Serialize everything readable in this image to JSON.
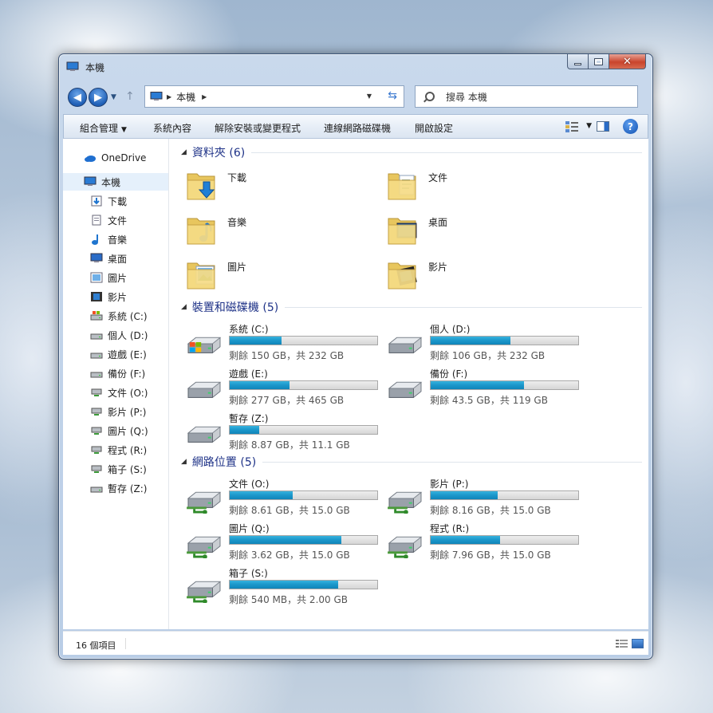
{
  "window": {
    "title": "本機"
  },
  "address": {
    "path": "本機",
    "search_placeholder": "搜尋 本機"
  },
  "toolbar": {
    "organize": "組合管理",
    "system_properties": "系統內容",
    "uninstall": "解除安裝或變更程式",
    "map_network_drive": "連線網路磁碟機",
    "control_panel": "開啟設定"
  },
  "sidebar": {
    "onedrive": "OneDrive",
    "this_pc": "本機",
    "items": [
      {
        "label": "下載",
        "icon": "download-folder-icon"
      },
      {
        "label": "文件",
        "icon": "documents-icon"
      },
      {
        "label": "音樂",
        "icon": "music-icon"
      },
      {
        "label": "桌面",
        "icon": "desktop-icon"
      },
      {
        "label": "圖片",
        "icon": "pictures-icon"
      },
      {
        "label": "影片",
        "icon": "videos-icon"
      },
      {
        "label": "系統 (C:)",
        "icon": "system-drive-icon"
      },
      {
        "label": "個人 (D:)",
        "icon": "drive-icon"
      },
      {
        "label": "遊戲 (E:)",
        "icon": "drive-icon"
      },
      {
        "label": "備份 (F:)",
        "icon": "drive-icon"
      },
      {
        "label": "文件 (O:)",
        "icon": "network-drive-icon"
      },
      {
        "label": "影片 (P:)",
        "icon": "network-drive-icon"
      },
      {
        "label": "圖片 (Q:)",
        "icon": "network-drive-icon"
      },
      {
        "label": "程式 (R:)",
        "icon": "network-drive-icon"
      },
      {
        "label": "箱子 (S:)",
        "icon": "network-drive-icon"
      },
      {
        "label": "暫存 (Z:)",
        "icon": "drive-icon"
      }
    ]
  },
  "groups": {
    "folders": {
      "title": "資料夾 (6)"
    },
    "devices": {
      "title": "裝置和磁碟機 (5)"
    },
    "network": {
      "title": "網路位置 (5)"
    }
  },
  "folders": [
    {
      "name": "下載",
      "icon": "downloads-folder-icon"
    },
    {
      "name": "文件",
      "icon": "documents-folder-icon"
    },
    {
      "name": "音樂",
      "icon": "music-folder-icon"
    },
    {
      "name": "桌面",
      "icon": "desktop-folder-icon"
    },
    {
      "name": "圖片",
      "icon": "pictures-folder-icon"
    },
    {
      "name": "影片",
      "icon": "videos-folder-icon"
    }
  ],
  "drives": [
    {
      "name": "系統 (C:)",
      "free": "剩餘 150 GB，共 232 GB",
      "used_fraction": 0.353,
      "icon": "windows-drive-icon"
    },
    {
      "name": "個人 (D:)",
      "free": "剩餘 106 GB，共 232 GB",
      "used_fraction": 0.543,
      "icon": "drive-icon"
    },
    {
      "name": "遊戲 (E:)",
      "free": "剩餘 277 GB，共 465 GB",
      "used_fraction": 0.404,
      "icon": "drive-icon"
    },
    {
      "name": "備份 (F:)",
      "free": "剩餘 43.5 GB，共 119 GB",
      "used_fraction": 0.634,
      "icon": "drive-icon"
    },
    {
      "name": "暫存 (Z:)",
      "free": "剩餘 8.87 GB，共 11.1 GB",
      "used_fraction": 0.2,
      "icon": "drive-icon"
    }
  ],
  "network": [
    {
      "name": "文件 (O:)",
      "free": "剩餘 8.61 GB，共 15.0 GB",
      "used_fraction": 0.426,
      "icon": "network-drive-icon"
    },
    {
      "name": "影片 (P:)",
      "free": "剩餘 8.16 GB，共 15.0 GB",
      "used_fraction": 0.456,
      "icon": "network-drive-icon"
    },
    {
      "name": "圖片 (Q:)",
      "free": "剩餘 3.62 GB，共 15.0 GB",
      "used_fraction": 0.759,
      "icon": "network-drive-icon"
    },
    {
      "name": "程式 (R:)",
      "free": "剩餘 7.96 GB，共 15.0 GB",
      "used_fraction": 0.469,
      "icon": "network-drive-icon"
    },
    {
      "name": "箱子 (S:)",
      "free": "剩餘 540 MB，共 2.00 GB",
      "used_fraction": 0.736,
      "icon": "network-drive-icon"
    }
  ],
  "status": {
    "count": "16 個項目"
  }
}
